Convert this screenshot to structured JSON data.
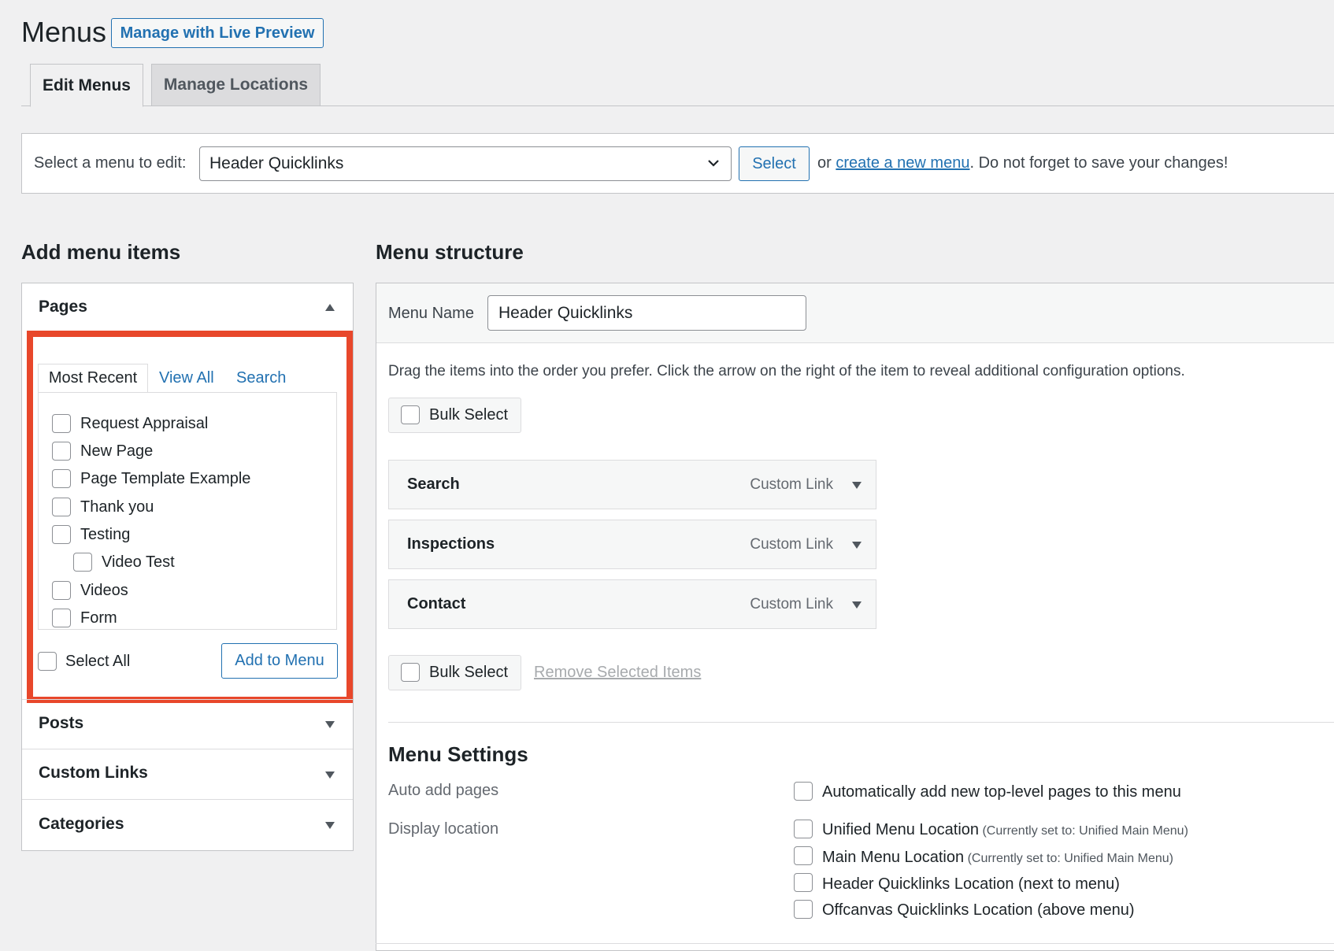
{
  "header": {
    "title": "Menus",
    "live_preview_button": "Manage with Live Preview",
    "tabs": [
      {
        "label": "Edit Menus",
        "active": true
      },
      {
        "label": "Manage Locations",
        "active": false
      }
    ]
  },
  "menu_select": {
    "label": "Select a menu to edit:",
    "selected": "Header Quicklinks",
    "select_button": "Select",
    "or_text": "or",
    "create_link": "create a new menu",
    "reminder": ". Do not forget to save your changes!"
  },
  "add_items": {
    "heading": "Add menu items",
    "pages": {
      "title": "Pages",
      "tabs": [
        "Most Recent",
        "View All",
        "Search"
      ],
      "items": [
        {
          "label": "Request Appraisal"
        },
        {
          "label": "New Page"
        },
        {
          "label": "Page Template Example"
        },
        {
          "label": "Thank you"
        },
        {
          "label": "Testing"
        },
        {
          "label": "Video Test"
        },
        {
          "label": "Videos"
        },
        {
          "label": "Form"
        }
      ],
      "select_all": "Select All",
      "add_button": "Add to Menu"
    },
    "sections": [
      "Posts",
      "Custom Links",
      "Categories"
    ]
  },
  "structure": {
    "heading": "Menu structure",
    "menu_name_label": "Menu Name",
    "menu_name_value": "Header Quicklinks",
    "instructions": "Drag the items into the order you prefer. Click the arrow on the right of the item to reveal additional configuration options.",
    "bulk_select": "Bulk Select",
    "items": [
      {
        "title": "Search",
        "type": "Custom Link"
      },
      {
        "title": "Inspections",
        "type": "Custom Link"
      },
      {
        "title": "Contact",
        "type": "Custom Link"
      }
    ],
    "remove_selected": "Remove Selected Items"
  },
  "settings": {
    "heading": "Menu Settings",
    "auto_add_label": "Auto add pages",
    "auto_add_option": "Automatically add new top-level pages to this menu",
    "display_location_label": "Display location",
    "locations": [
      {
        "label": "Unified Menu Location",
        "note": "(Currently set to: Unified Main Menu)"
      },
      {
        "label": "Main Menu Location",
        "note": "(Currently set to: Unified Main Menu)"
      },
      {
        "label": "Header Quicklinks Location (next to menu)",
        "note": ""
      },
      {
        "label": "Offcanvas Quicklinks Location (above menu)",
        "note": ""
      }
    ]
  },
  "colors": {
    "accent": "#2271b1",
    "highlight": "#e8472b",
    "background": "#f0f0f1"
  }
}
